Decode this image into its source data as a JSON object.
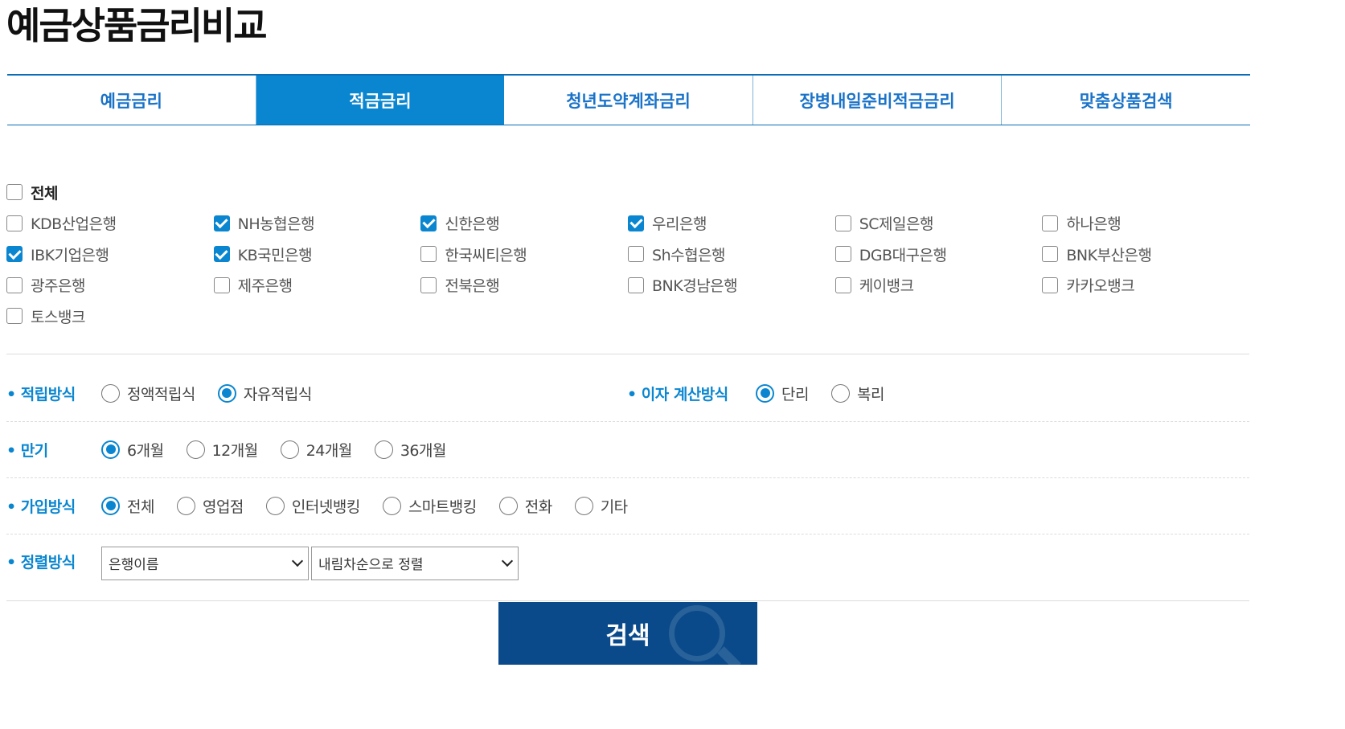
{
  "page_title": "예금상품금리비교",
  "tabs": [
    {
      "label": "예금금리",
      "active": false
    },
    {
      "label": "적금금리",
      "active": true
    },
    {
      "label": "청년도약계좌금리",
      "active": false
    },
    {
      "label": "장병내일준비적금금리",
      "active": false
    },
    {
      "label": "맞춤상품검색",
      "active": false
    }
  ],
  "banks": {
    "all_label": "전체",
    "all_checked": false,
    "items": [
      {
        "label": "KDB산업은행",
        "checked": false
      },
      {
        "label": "NH농협은행",
        "checked": true
      },
      {
        "label": "신한은행",
        "checked": true
      },
      {
        "label": "우리은행",
        "checked": true
      },
      {
        "label": "SC제일은행",
        "checked": false
      },
      {
        "label": "하나은행",
        "checked": false
      },
      {
        "label": "IBK기업은행",
        "checked": true
      },
      {
        "label": "KB국민은행",
        "checked": true
      },
      {
        "label": "한국씨티은행",
        "checked": false
      },
      {
        "label": "Sh수협은행",
        "checked": false
      },
      {
        "label": "DGB대구은행",
        "checked": false
      },
      {
        "label": "BNK부산은행",
        "checked": false
      },
      {
        "label": "광주은행",
        "checked": false
      },
      {
        "label": "제주은행",
        "checked": false
      },
      {
        "label": "전북은행",
        "checked": false
      },
      {
        "label": "BNK경남은행",
        "checked": false
      },
      {
        "label": "케이뱅크",
        "checked": false
      },
      {
        "label": "카카오뱅크",
        "checked": false
      },
      {
        "label": "토스뱅크",
        "checked": false
      }
    ]
  },
  "savings_method": {
    "label": "적립방식",
    "options": [
      {
        "label": "정액적립식",
        "selected": false
      },
      {
        "label": "자유적립식",
        "selected": true
      }
    ]
  },
  "interest_method": {
    "label": "이자 계산방식",
    "options": [
      {
        "label": "단리",
        "selected": true
      },
      {
        "label": "복리",
        "selected": false
      }
    ]
  },
  "term": {
    "label": "만기",
    "options": [
      {
        "label": "6개월",
        "selected": true
      },
      {
        "label": "12개월",
        "selected": false
      },
      {
        "label": "24개월",
        "selected": false
      },
      {
        "label": "36개월",
        "selected": false
      }
    ]
  },
  "join_method": {
    "label": "가입방식",
    "options": [
      {
        "label": "전체",
        "selected": true
      },
      {
        "label": "영업점",
        "selected": false
      },
      {
        "label": "인터넷뱅킹",
        "selected": false
      },
      {
        "label": "스마트뱅킹",
        "selected": false
      },
      {
        "label": "전화",
        "selected": false
      },
      {
        "label": "기타",
        "selected": false
      }
    ]
  },
  "sort": {
    "label": "정렬방식",
    "field_value": "은행이름",
    "order_value": "내림차순으로 정렬"
  },
  "search_button": "검색",
  "colors": {
    "accent": "#0a86d0",
    "button": "#0a4a8a"
  }
}
